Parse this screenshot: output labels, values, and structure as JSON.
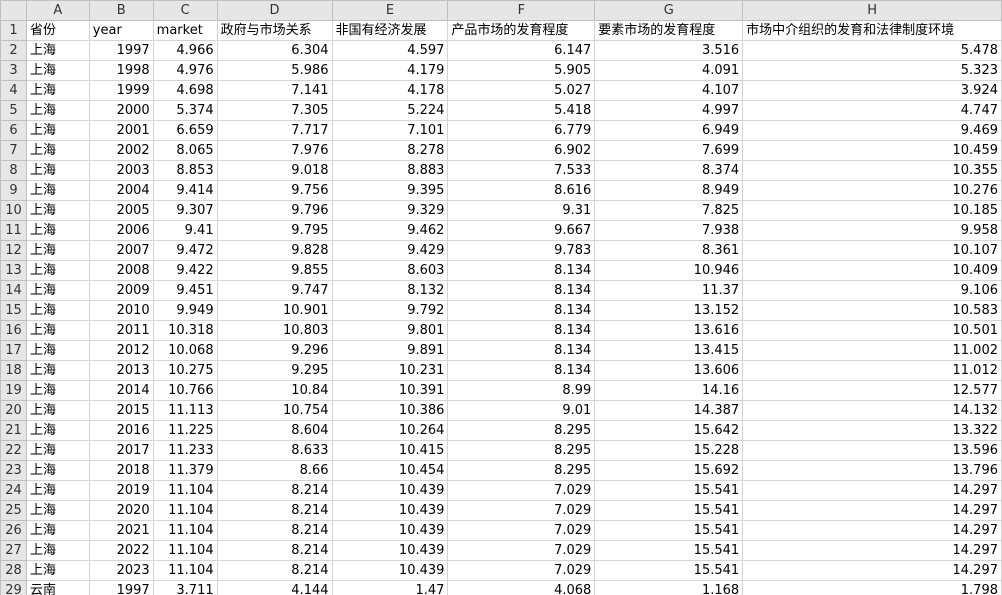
{
  "columns": [
    "A",
    "B",
    "C",
    "D",
    "E",
    "F",
    "G",
    "H"
  ],
  "header_row": [
    "省份",
    "year",
    "market",
    "政府与市场关系",
    "非国有经济发展",
    "产品市场的发育程度",
    "要素市场的发育程度",
    "市场中介组织的发育和法律制度环境"
  ],
  "rows": [
    [
      "上海",
      "1997",
      "4.966",
      "6.304",
      "4.597",
      "6.147",
      "3.516",
      "5.478"
    ],
    [
      "上海",
      "1998",
      "4.976",
      "5.986",
      "4.179",
      "5.905",
      "4.091",
      "5.323"
    ],
    [
      "上海",
      "1999",
      "4.698",
      "7.141",
      "4.178",
      "5.027",
      "4.107",
      "3.924"
    ],
    [
      "上海",
      "2000",
      "5.374",
      "7.305",
      "5.224",
      "5.418",
      "4.997",
      "4.747"
    ],
    [
      "上海",
      "2001",
      "6.659",
      "7.717",
      "7.101",
      "6.779",
      "6.949",
      "9.469"
    ],
    [
      "上海",
      "2002",
      "8.065",
      "7.976",
      "8.278",
      "6.902",
      "7.699",
      "10.459"
    ],
    [
      "上海",
      "2003",
      "8.853",
      "9.018",
      "8.883",
      "7.533",
      "8.374",
      "10.355"
    ],
    [
      "上海",
      "2004",
      "9.414",
      "9.756",
      "9.395",
      "8.616",
      "8.949",
      "10.276"
    ],
    [
      "上海",
      "2005",
      "9.307",
      "9.796",
      "9.329",
      "9.31",
      "7.825",
      "10.185"
    ],
    [
      "上海",
      "2006",
      "9.41",
      "9.795",
      "9.462",
      "9.667",
      "7.938",
      "9.958"
    ],
    [
      "上海",
      "2007",
      "9.472",
      "9.828",
      "9.429",
      "9.783",
      "8.361",
      "10.107"
    ],
    [
      "上海",
      "2008",
      "9.422",
      "9.855",
      "8.603",
      "8.134",
      "10.946",
      "10.409"
    ],
    [
      "上海",
      "2009",
      "9.451",
      "9.747",
      "8.132",
      "8.134",
      "11.37",
      "9.106"
    ],
    [
      "上海",
      "2010",
      "9.949",
      "10.901",
      "9.792",
      "8.134",
      "13.152",
      "10.583"
    ],
    [
      "上海",
      "2011",
      "10.318",
      "10.803",
      "9.801",
      "8.134",
      "13.616",
      "10.501"
    ],
    [
      "上海",
      "2012",
      "10.068",
      "9.296",
      "9.891",
      "8.134",
      "13.415",
      "11.002"
    ],
    [
      "上海",
      "2013",
      "10.275",
      "9.295",
      "10.231",
      "8.134",
      "13.606",
      "11.012"
    ],
    [
      "上海",
      "2014",
      "10.766",
      "10.84",
      "10.391",
      "8.99",
      "14.16",
      "12.577"
    ],
    [
      "上海",
      "2015",
      "11.113",
      "10.754",
      "10.386",
      "9.01",
      "14.387",
      "14.132"
    ],
    [
      "上海",
      "2016",
      "11.225",
      "8.604",
      "10.264",
      "8.295",
      "15.642",
      "13.322"
    ],
    [
      "上海",
      "2017",
      "11.233",
      "8.633",
      "10.415",
      "8.295",
      "15.228",
      "13.596"
    ],
    [
      "上海",
      "2018",
      "11.379",
      "8.66",
      "10.454",
      "8.295",
      "15.692",
      "13.796"
    ],
    [
      "上海",
      "2019",
      "11.104",
      "8.214",
      "10.439",
      "7.029",
      "15.541",
      "14.297"
    ],
    [
      "上海",
      "2020",
      "11.104",
      "8.214",
      "10.439",
      "7.029",
      "15.541",
      "14.297"
    ],
    [
      "上海",
      "2021",
      "11.104",
      "8.214",
      "10.439",
      "7.029",
      "15.541",
      "14.297"
    ],
    [
      "上海",
      "2022",
      "11.104",
      "8.214",
      "10.439",
      "7.029",
      "15.541",
      "14.297"
    ],
    [
      "上海",
      "2023",
      "11.104",
      "8.214",
      "10.439",
      "7.029",
      "15.541",
      "14.297"
    ],
    [
      "云南",
      "1997",
      "3.711",
      "4.144",
      "1.47",
      "4.068",
      "1.168",
      "1.798"
    ]
  ]
}
